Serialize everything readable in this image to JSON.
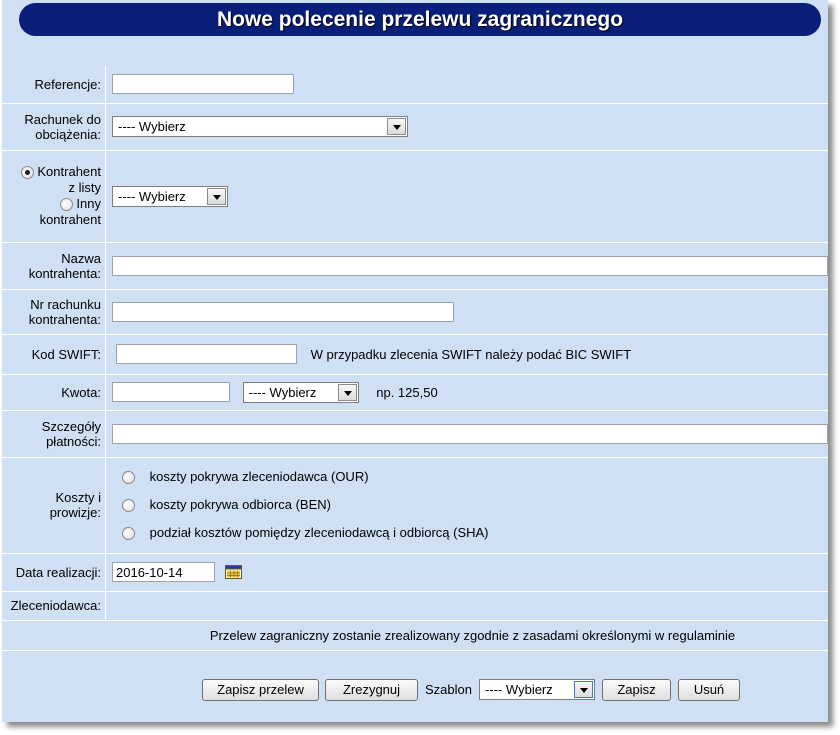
{
  "title": "Nowe polecenie przelewu zagranicznego",
  "fields": {
    "referencje": {
      "label": "Referencje:",
      "value": ""
    },
    "rachunek": {
      "label": "Rachunek do obciążenia:",
      "label_line1": "Rachunek do",
      "label_line2": "obciążenia:",
      "selected": "---- Wybierz"
    },
    "kontrahent": {
      "radio_list_line1": "Kontrahent",
      "radio_list_line2": "z listy",
      "radio_other_line1": "Inny",
      "radio_other_line2": "kontrahent",
      "selected_radio": "z listy",
      "selected": "---- Wybierz"
    },
    "nazwa": {
      "label_line1": "Nazwa",
      "label_line2": "kontrahenta:",
      "value": ""
    },
    "nr_rachunku": {
      "label_line1": "Nr rachunku",
      "label_line2": "kontrahenta:",
      "value": ""
    },
    "kod_swift": {
      "label": "Kod SWIFT:",
      "value": "",
      "hint": "W przypadku zlecenia SWIFT należy podać BIC SWIFT"
    },
    "kwota": {
      "label": "Kwota:",
      "value": "",
      "currency_selected": "---- Wybierz",
      "hint": "np. 125,50"
    },
    "szczegoly": {
      "label_line1": "Szczegóły",
      "label_line2": "płatności:",
      "value": ""
    },
    "koszty": {
      "label_line1": "Koszty i",
      "label_line2": "prowizje:",
      "options": [
        "koszty pokrywa zleceniodawca (OUR)",
        "koszty pokrywa odbiorca (BEN)",
        "podział kosztów pomiędzy zleceniodawcą i odbiorcą (SHA)"
      ]
    },
    "data": {
      "label": "Data realizacji:",
      "value": "2016-10-14",
      "icon": "calendar-icon"
    },
    "zleceniodawca": {
      "label": "Zleceniodawca:",
      "value": ""
    }
  },
  "notice": "Przelew zagraniczny zostanie zrealizowany zgodnie z zasadami określonymi w regulaminie",
  "actions": {
    "save": "Zapisz przelew",
    "cancel": "Zrezygnuj",
    "template_label": "Szablon",
    "template_selected": "---- Wybierz",
    "template_save": "Zapisz",
    "template_delete": "Usuń"
  },
  "colors": {
    "title_bg": "#0a1f7a",
    "panel_bg": "#cfe0f4"
  }
}
